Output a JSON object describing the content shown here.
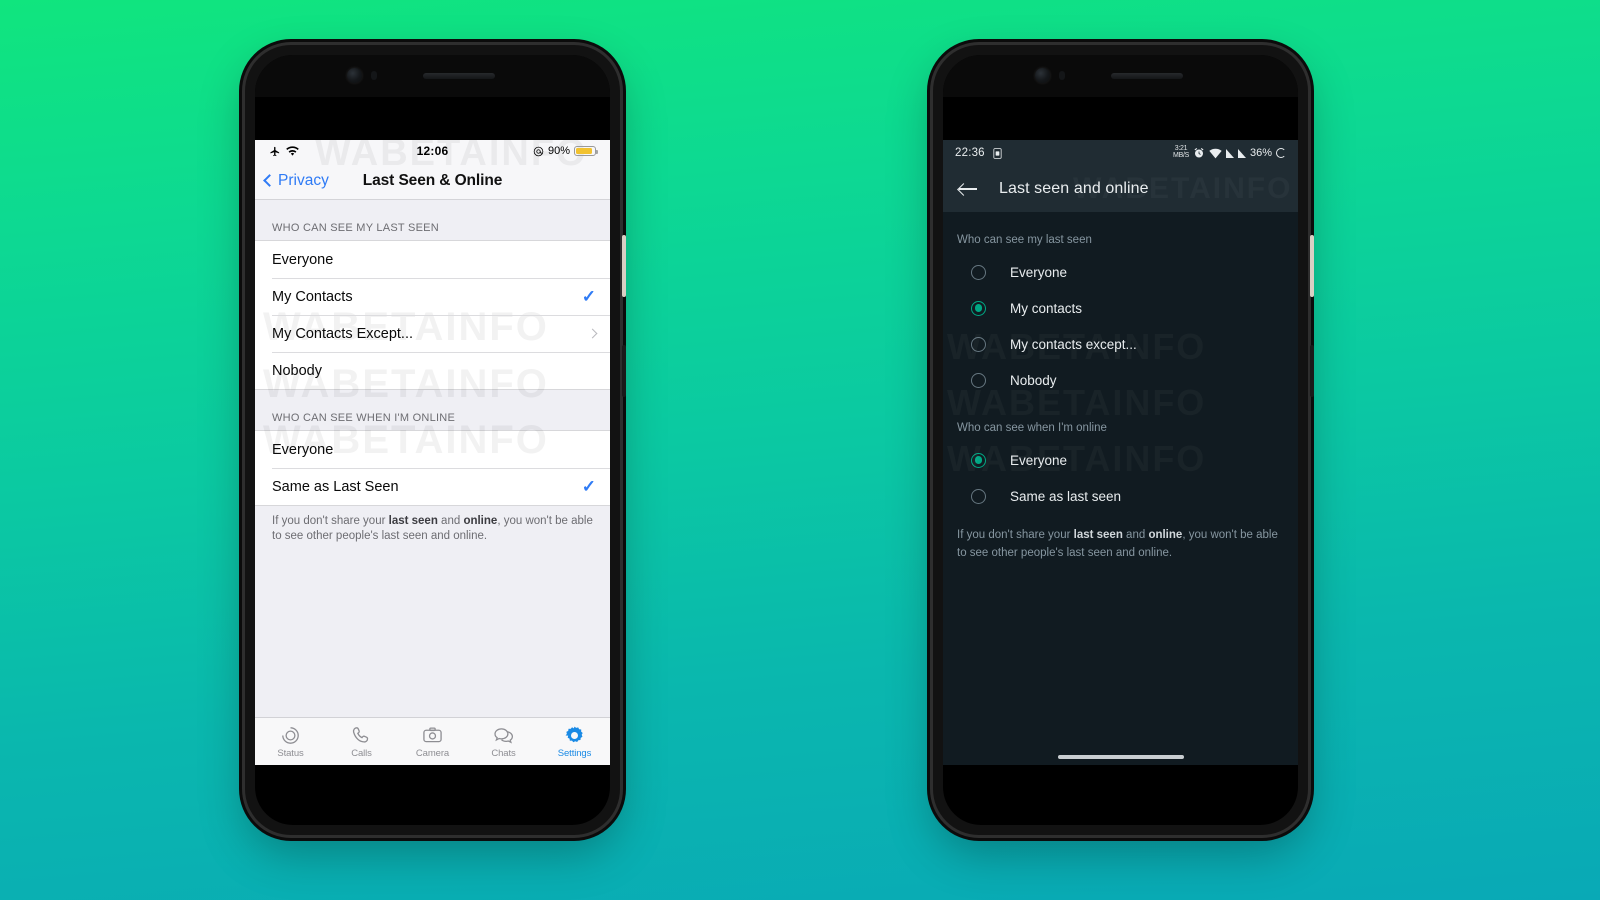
{
  "background": {
    "gradient_from": "#10E57E",
    "gradient_to": "#09A9B6"
  },
  "watermark": {
    "text": "WABETAINFO"
  },
  "ios_phone": {
    "status_bar": {
      "airplane_icon": "airplane-icon",
      "wifi_icon": "wifi-icon",
      "time": "12:06",
      "lowpower_icon": "low-power-icon",
      "battery_percent": "90%",
      "battery_color": "#f2c230"
    },
    "nav": {
      "back_label": "Privacy",
      "title": "Last Seen & Online"
    },
    "sections": [
      {
        "header": "WHO CAN SEE MY LAST SEEN",
        "rows": [
          {
            "label": "Everyone",
            "accessory": "none"
          },
          {
            "label": "My Contacts",
            "accessory": "check"
          },
          {
            "label": "My Contacts Except...",
            "accessory": "chevron"
          },
          {
            "label": "Nobody",
            "accessory": "none"
          }
        ]
      },
      {
        "header": "WHO CAN SEE WHEN I'M ONLINE",
        "rows": [
          {
            "label": "Everyone",
            "accessory": "none"
          },
          {
            "label": "Same as Last Seen",
            "accessory": "check"
          }
        ],
        "footer_parts": [
          {
            "t": "If you don't share your ",
            "b": false
          },
          {
            "t": "last seen",
            "b": true
          },
          {
            "t": " and ",
            "b": false
          },
          {
            "t": "online",
            "b": true
          },
          {
            "t": ", you won't be able to see other people's last seen and online.",
            "b": false
          }
        ]
      }
    ],
    "tabbar": {
      "accent": "#1a8ae5",
      "items": [
        {
          "label": "Status",
          "icon": "status-icon",
          "active": false
        },
        {
          "label": "Calls",
          "icon": "phone-icon",
          "active": false
        },
        {
          "label": "Camera",
          "icon": "camera-icon",
          "active": false
        },
        {
          "label": "Chats",
          "icon": "chat-icon",
          "active": false
        },
        {
          "label": "Settings",
          "icon": "gear-icon",
          "active": true
        }
      ]
    }
  },
  "android_phone": {
    "status_bar": {
      "time": "22:36",
      "sim_icon": "sim-card-icon",
      "nfc_icon": "nfc-icon",
      "alarm_icon": "alarm-icon",
      "wifi_icon": "wifi-icon",
      "signal_icon_1": "signal-icon",
      "signal_icon_2": "signal-icon",
      "battery_percent": "36%",
      "battery_icon": "battery-circle-icon"
    },
    "nav": {
      "back_icon": "arrow-left-icon",
      "title": "Last seen and online"
    },
    "accent": "#00a884",
    "sections": [
      {
        "header": "Who can see my last seen",
        "rows": [
          {
            "label": "Everyone",
            "selected": false
          },
          {
            "label": "My contacts",
            "selected": true
          },
          {
            "label": "My contacts except...",
            "selected": false
          },
          {
            "label": "Nobody",
            "selected": false
          }
        ]
      },
      {
        "header": "Who can see when I'm online",
        "rows": [
          {
            "label": "Everyone",
            "selected": true
          },
          {
            "label": "Same as last seen",
            "selected": false
          }
        ],
        "footer_parts": [
          {
            "t": "If you don't share your ",
            "b": false
          },
          {
            "t": "last seen",
            "b": true
          },
          {
            "t": " and ",
            "b": false
          },
          {
            "t": "online",
            "b": true
          },
          {
            "t": ", you won't be able to see other people's last seen and online.",
            "b": false
          }
        ]
      }
    ]
  }
}
